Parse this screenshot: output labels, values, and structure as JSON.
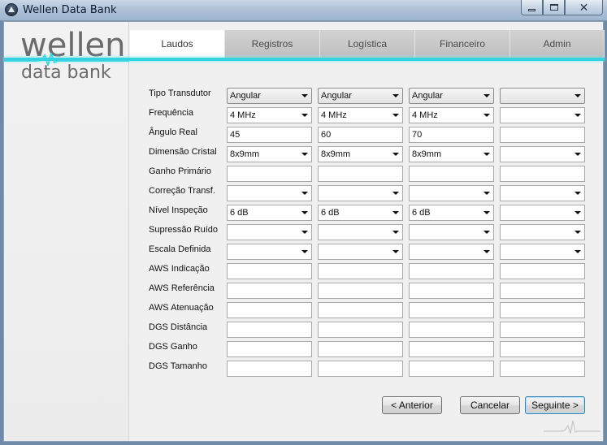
{
  "window": {
    "title": "Wellen Data Bank"
  },
  "logo": {
    "top": "wellen",
    "bottom": "data bank"
  },
  "tabs": [
    {
      "label": "Laudos",
      "active": true
    },
    {
      "label": "Registros",
      "active": false
    },
    {
      "label": "Logística",
      "active": false
    },
    {
      "label": "Financeiro",
      "active": false
    },
    {
      "label": "Admin",
      "active": false
    }
  ],
  "form": {
    "labels": [
      "Tipo Transdutor",
      "Frequência",
      "Ângulo Real",
      "Dimensão Cristal",
      "Ganho Primário",
      "Correção Transf.",
      "Nível Inspeção",
      "Supressão Ruído",
      "Escala Definida",
      "AWS Indicação",
      "AWS Referência",
      "AWS Atenuação",
      "DGS Distância",
      "DGS Ganho",
      "DGS Tamanho"
    ],
    "rows": {
      "tipo_transdutor": [
        "Angular",
        "Angular",
        "Angular",
        ""
      ],
      "frequencia": [
        "4 MHz",
        "4 MHz",
        "4 MHz",
        ""
      ],
      "angulo_real": [
        "45",
        "60",
        "70",
        ""
      ],
      "dimensao_cristal": [
        "8x9mm",
        "8x9mm",
        "8x9mm",
        ""
      ],
      "ganho_primario": [
        "",
        "",
        "",
        ""
      ],
      "correcao_transf": [
        "",
        "",
        "",
        ""
      ],
      "nivel_inspecao": [
        "6 dB",
        "6 dB",
        "6 dB",
        ""
      ],
      "supressao_ruido": [
        "",
        "",
        "",
        ""
      ],
      "escala_definida": [
        "",
        "",
        "",
        ""
      ],
      "aws_indicacao": [
        "",
        "",
        "",
        ""
      ],
      "aws_referencia": [
        "",
        "",
        "",
        ""
      ],
      "aws_atenuacao": [
        "",
        "",
        "",
        ""
      ],
      "dgs_distancia": [
        "",
        "",
        "",
        ""
      ],
      "dgs_ganho": [
        "",
        "",
        "",
        ""
      ],
      "dgs_tamanho": [
        "",
        "",
        "",
        ""
      ]
    }
  },
  "buttons": {
    "back": "< Anterior",
    "cancel": "Cancelar",
    "next": "Seguinte >"
  },
  "colors": {
    "accent": "#35d3df",
    "titlebar": "#aec2d8"
  },
  "icons": {
    "app": "app-logo-icon",
    "minimize": "minimize-icon",
    "maximize": "maximize-icon",
    "close": "close-icon"
  }
}
